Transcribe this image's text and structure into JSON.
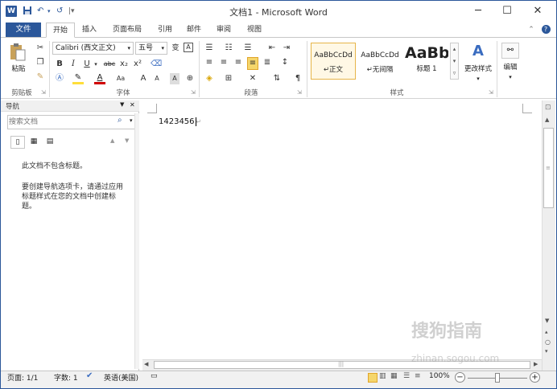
{
  "title": "文档1 - Microsoft Word",
  "app_icon": "W",
  "qat": {
    "save_icon": "save-icon",
    "undo": "↶",
    "redo": "↺",
    "more": "▾"
  },
  "tabs": [
    "文件",
    "开始",
    "插入",
    "页面布局",
    "引用",
    "邮件",
    "审阅",
    "视图"
  ],
  "ribbon": {
    "clipboard": {
      "paste": "粘贴",
      "label": "剪贴板"
    },
    "font": {
      "name": "Calibri (西文正文)",
      "size": "五号",
      "label": "字体",
      "bold": "B",
      "italic": "I",
      "underline": "U",
      "strike": "abc",
      "sub": "x₂",
      "sup": "x²",
      "grow": "A",
      "shrink": "A",
      "case": "Aa",
      "clear": "A"
    },
    "paragraph": {
      "label": "段落"
    },
    "styles": {
      "label": "样式",
      "cards": [
        {
          "sample": "AaBbCcDd",
          "name": "↵正文"
        },
        {
          "sample": "AaBbCcDd",
          "name": "↵无间隔"
        },
        {
          "sample": "AaBb",
          "name": "标题 1"
        }
      ],
      "change": "更改样式"
    },
    "editing": {
      "label": "编辑"
    }
  },
  "nav": {
    "title": "导航",
    "search_placeholder": "搜索文档",
    "msg1": "此文档不包含标题。",
    "msg2": "要创建导航选项卡，请通过应用标题样式在您的文档中创建标题。"
  },
  "document": {
    "text": "1423456"
  },
  "status": {
    "page": "页面: 1/1",
    "words": "字数: 1",
    "language": "英语(美国)",
    "zoom": "100%"
  },
  "watermark": {
    "text": "搜狗指南",
    "url": "zhinan.sogou.com"
  },
  "colors": {
    "accent": "#2b579a",
    "highlight": "#ffde3a",
    "font_color": "#d00000"
  }
}
